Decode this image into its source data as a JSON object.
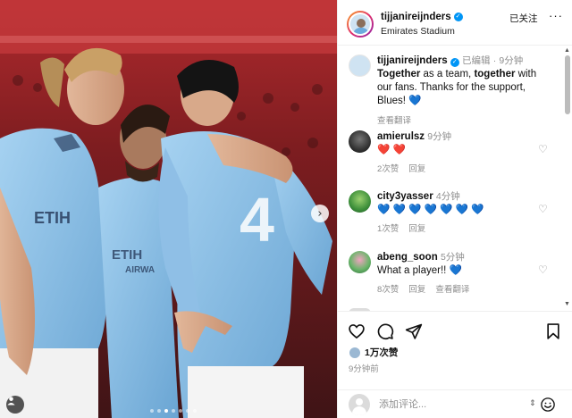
{
  "header": {
    "username": "tijjanireijnders",
    "location": "Emirates Stadium",
    "follow_label": "已关注",
    "more_label": "···"
  },
  "caption": {
    "username": "tijjanireijnders",
    "edited": "已编辑",
    "time": "9分钟",
    "text_parts": [
      "Together",
      " as a team, ",
      "together",
      " with our fans. Thanks for the support, Blues! "
    ],
    "emoji": "💙",
    "translate_label": "查看翻译"
  },
  "comments": [
    {
      "username": "amierulsz",
      "time": "9分钟",
      "text": "❤️ ❤️",
      "likes": "2次赞",
      "reply": "回复",
      "translate": ""
    },
    {
      "username": "city3yasser",
      "time": "4分钟",
      "text": "💙 💙 💙 💙 💙 💙 💙",
      "likes": "1次赞",
      "reply": "回复",
      "translate": ""
    },
    {
      "username": "abeng_soon",
      "time": "5分钟",
      "text": "What a player!! 💙",
      "likes": "8次赞",
      "reply": "回复",
      "translate": "查看翻译"
    }
  ],
  "actions": {
    "like_count": "1万次赞",
    "posted_ago": "9分钟前"
  },
  "composer": {
    "placeholder": "添加评论..."
  },
  "photo": {
    "next_label": "›",
    "page_count": 7,
    "current_page": 3,
    "jersey_number": "4",
    "sponsor_text": "ETIHAD AIRWAYS"
  },
  "colors": {
    "accent": "#0095f6",
    "kit_blue": "#8fc3ea",
    "kit_blue_dark": "#6fa9d6",
    "stand_red": "#8b1f22",
    "heart_red": "#ed4956",
    "meta_grey": "#8e8e8e"
  }
}
